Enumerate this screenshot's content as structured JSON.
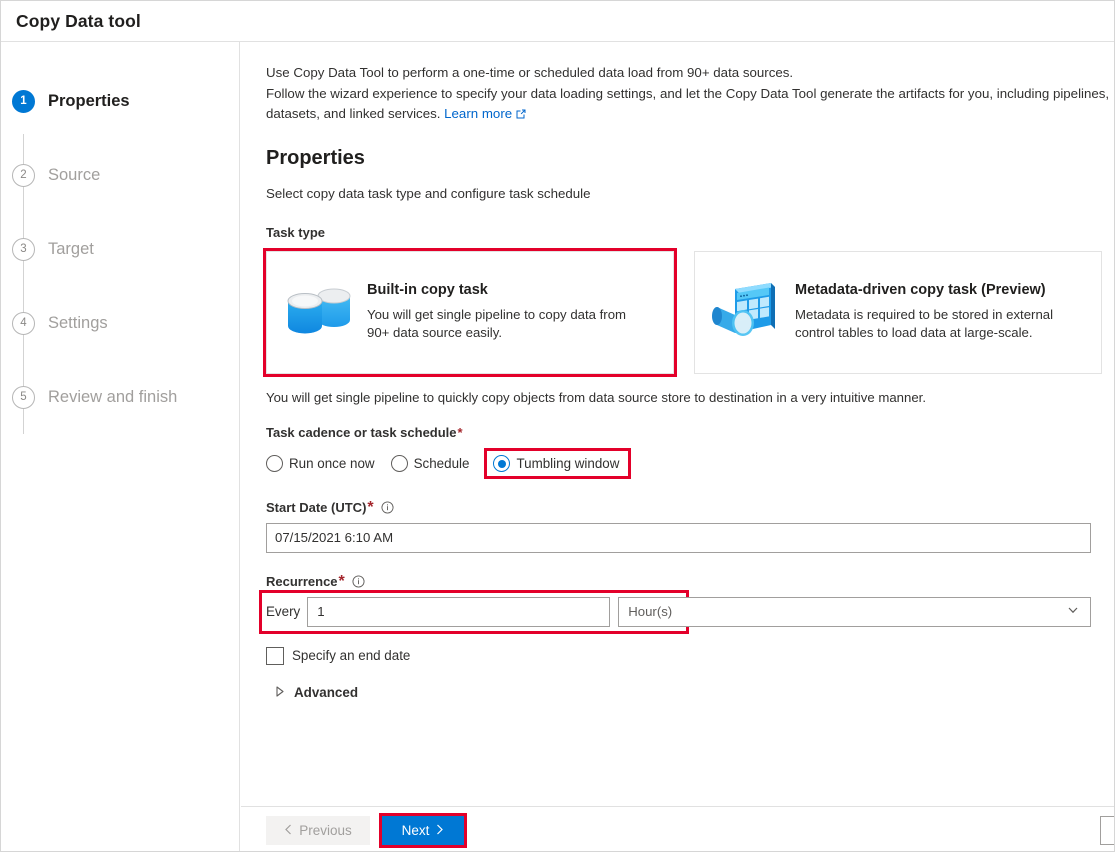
{
  "window": {
    "title": "Copy Data tool"
  },
  "sidebar": {
    "steps": [
      {
        "num": "1",
        "label": "Properties",
        "active": true
      },
      {
        "num": "2",
        "label": "Source",
        "active": false
      },
      {
        "num": "3",
        "label": "Target",
        "active": false
      },
      {
        "num": "4",
        "label": "Settings",
        "active": false
      },
      {
        "num": "5",
        "label": "Review and finish",
        "active": false
      }
    ]
  },
  "intro": {
    "line1": "Use Copy Data Tool to perform a one-time or scheduled data load from 90+ data sources.",
    "line2": "Follow the wizard experience to specify your data loading settings, and let the Copy Data Tool generate the artifacts for you, including pipelines, datasets, and linked services.",
    "link_label": "Learn more",
    "link_icon": "external-link-icon"
  },
  "section": {
    "title": "Properties",
    "subtitle": "Select copy data task type and configure task schedule"
  },
  "task_type": {
    "label": "Task type",
    "cards": [
      {
        "title": "Built-in copy task",
        "description": "You will get single pipeline to copy data from 90+ data source easily.",
        "icon": "database-copy-icon",
        "selected": true
      },
      {
        "title": "Metadata-driven copy task (Preview)",
        "description": "Metadata is required to be stored in external control tables to load data at large-scale.",
        "icon": "metadata-table-magnifier-icon",
        "selected": false
      }
    ],
    "note": "You will get single pipeline to quickly copy objects from data source store to destination in a very intuitive manner."
  },
  "cadence": {
    "label": "Task cadence or task schedule",
    "required_mark": "*",
    "options": [
      {
        "label": "Run once now",
        "checked": false
      },
      {
        "label": "Schedule",
        "checked": false
      },
      {
        "label": "Tumbling window",
        "checked": true,
        "highlighted": true
      }
    ]
  },
  "start_date": {
    "label": "Start Date (UTC)",
    "required_mark": "*",
    "info_icon": "info-circle-icon",
    "value": "07/15/2021 6:10 AM"
  },
  "recurrence": {
    "label": "Recurrence",
    "required_mark": "*",
    "info_icon": "info-circle-icon",
    "every_label": "Every",
    "interval_value": "1",
    "unit_value": "Hour(s)",
    "chevron_icon": "chevron-down-icon",
    "highlighted": true
  },
  "end_date": {
    "checkbox_label": "Specify an end date",
    "checked": false
  },
  "advanced": {
    "label": "Advanced",
    "icon": "chevron-right-icon",
    "expanded": false
  },
  "footer": {
    "previous_label": "Previous",
    "previous_icon": "chevron-left-icon",
    "previous_disabled": true,
    "next_label": "Next",
    "next_icon": "chevron-right-icon",
    "next_highlighted": true
  },
  "colors": {
    "accent_blue": "#0078d4",
    "highlight_red": "#e3002a",
    "required_red": "#a4262c",
    "link_blue": "#0066cc",
    "text_primary": "#323130",
    "text_muted": "#a19f9d"
  }
}
